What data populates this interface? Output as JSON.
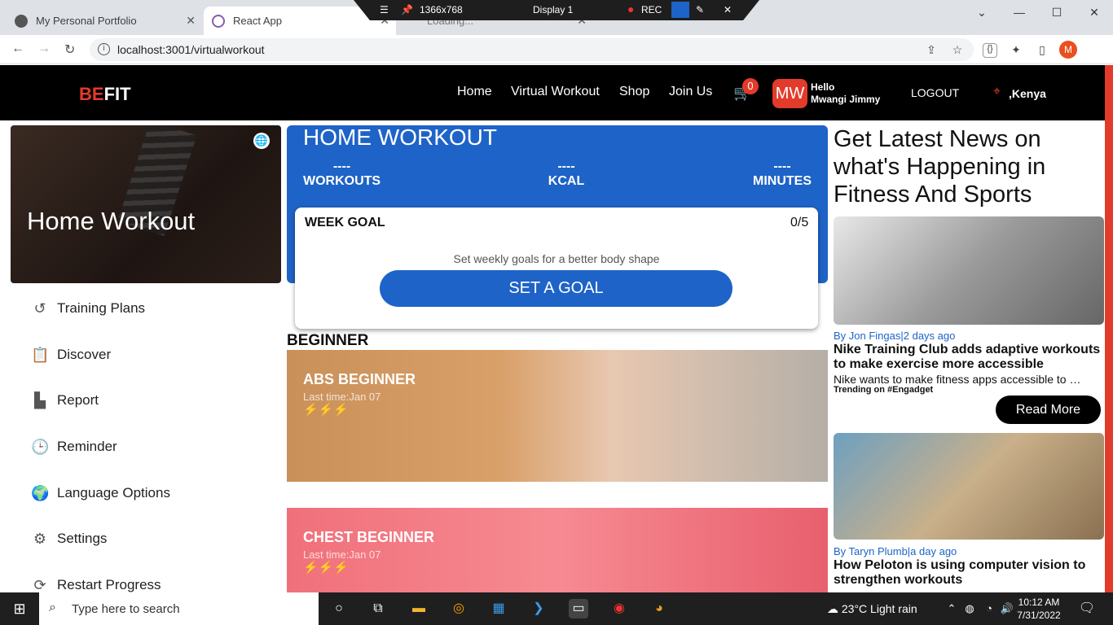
{
  "browser": {
    "tabs": [
      {
        "title": "My Personal Portfolio"
      },
      {
        "title": "React App"
      },
      {
        "title": "Loading..."
      }
    ],
    "url": "localhost:3001/virtualworkout",
    "profile_initial": "M"
  },
  "recorder": {
    "resolution": "1366x768",
    "display": "Display 1",
    "rec_label": "REC"
  },
  "app": {
    "logo_red": "BE",
    "logo_white": "FIT",
    "nav": [
      "Home",
      "Virtual Workout",
      "Shop",
      "Join Us"
    ],
    "cart_count": "0",
    "user_initials": "MW",
    "hello": "Hello",
    "user_name": "Mwangi Jimmy",
    "logout": "LOGOUT",
    "location": ",Kenya"
  },
  "sidebar": {
    "hero_title": "Home Workout",
    "items": [
      {
        "label": "Training Plans",
        "icon": "history-icon"
      },
      {
        "label": "Discover",
        "icon": "clipboard-check-icon"
      },
      {
        "label": "Report",
        "icon": "bar-chart-icon"
      },
      {
        "label": "Reminder",
        "icon": "clock-icon"
      },
      {
        "label": "Language Options",
        "icon": "globe-icon"
      },
      {
        "label": "Settings",
        "icon": "gear-icon"
      },
      {
        "label": "Restart Progress",
        "icon": "restart-icon"
      }
    ]
  },
  "workout": {
    "title": "HOME WORKOUT",
    "stats": [
      {
        "value": "----",
        "label": "WORKOUTS"
      },
      {
        "value": "----",
        "label": "KCAL"
      },
      {
        "value": "----",
        "label": "MINUTES"
      }
    ],
    "week_goal_label": "WEEK GOAL",
    "week_goal_count": "0/5",
    "goal_hint": "Set weekly goals for a better body shape",
    "set_goal_button": "SET A GOAL",
    "section": "BEGINNER",
    "cards": [
      {
        "title": "ABS BEGINNER",
        "last": "Last time:Jan 07",
        "level": 1
      },
      {
        "title": "CHEST BEGINNER",
        "last": "Last time:Jan 07",
        "level": 1
      }
    ]
  },
  "news": {
    "heading": "Get Latest News on what's Happening in Fitness And Sports",
    "articles": [
      {
        "byline": "By Jon Fingas|2 days ago",
        "headline": "Nike Training Club adds adaptive workouts to make exercise more accessible",
        "desc": "Nike wants to make fitness apps accessible to more people.",
        "trending": "Trending on #Engadget",
        "read_more": "Read More"
      },
      {
        "byline": "By Taryn Plumb|a day ago",
        "headline": "How Peloton is using computer vision to strengthen workouts"
      }
    ]
  },
  "taskbar": {
    "search_placeholder": "Type here to search",
    "weather": "23°C  Light rain",
    "time": "10:12 AM",
    "date": "7/31/2022"
  }
}
